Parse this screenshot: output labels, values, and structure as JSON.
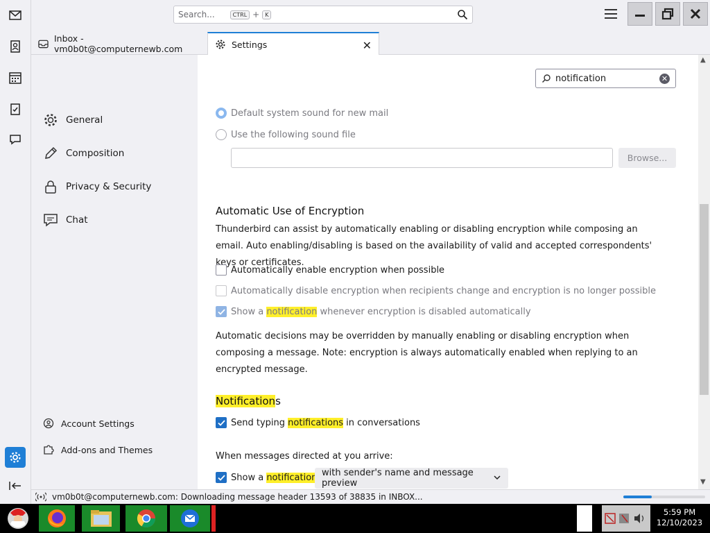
{
  "topbar": {
    "search_placeholder": "Search...",
    "kbd_ctrl": "CTRL",
    "kbd_plus": "+",
    "kbd_key": "K"
  },
  "tabs": [
    {
      "label": "Inbox - vm0b0t@computernewb.com"
    },
    {
      "label": "Settings"
    }
  ],
  "sidebar": {
    "items": [
      {
        "label": "General",
        "icon": "gear-icon"
      },
      {
        "label": "Composition",
        "icon": "pencil-icon"
      },
      {
        "label": "Privacy & Security",
        "icon": "lock-icon"
      },
      {
        "label": "Chat",
        "icon": "chat-icon"
      }
    ],
    "account_settings": "Account Settings",
    "addons": "Add-ons and Themes"
  },
  "main": {
    "filter_value": "notification",
    "sound": {
      "default_sound": "Default system sound for new mail",
      "use_file": "Use the following sound file",
      "browse_label": "Browse..."
    },
    "encryption": {
      "heading": "Automatic Use of Encryption",
      "description": "Thunderbird can assist by automatically enabling or disabling encryption while composing an email. Auto enabling/disabling is based on the availability of valid and accepted correspondents' keys or certificates.",
      "enable_label": "Automatically enable encryption when possible",
      "disable_label": "Automatically disable encryption when recipients change and encryption is no longer possible",
      "show_prefix": "Show a ",
      "show_highlight": "notification",
      "show_suffix": " whenever encryption is disabled automatically",
      "note": "Automatic decisions may be overridden by manually enabling or disabling encryption when composing a message. Note: encryption is always automatically enabled when replying to an encrypted message."
    },
    "notifications": {
      "heading_highlight": "Notification",
      "heading_rest": "s",
      "typing_prefix": "Send typing ",
      "typing_highlight": "notifications",
      "typing_suffix": " in conversations",
      "when_label": "When messages directed at you arrive:",
      "show_prefix": "Show a ",
      "show_highlight": "notification",
      "show_suffix": ":",
      "dropdown_value": "with sender's name and message preview"
    }
  },
  "statusbar": {
    "text": "vm0b0t@computernewb.com: Downloading message header 13593 of 38835 in INBOX...",
    "progress": 0.35
  },
  "taskbar": {
    "time": "5:59 PM",
    "date": "12/10/2023"
  }
}
